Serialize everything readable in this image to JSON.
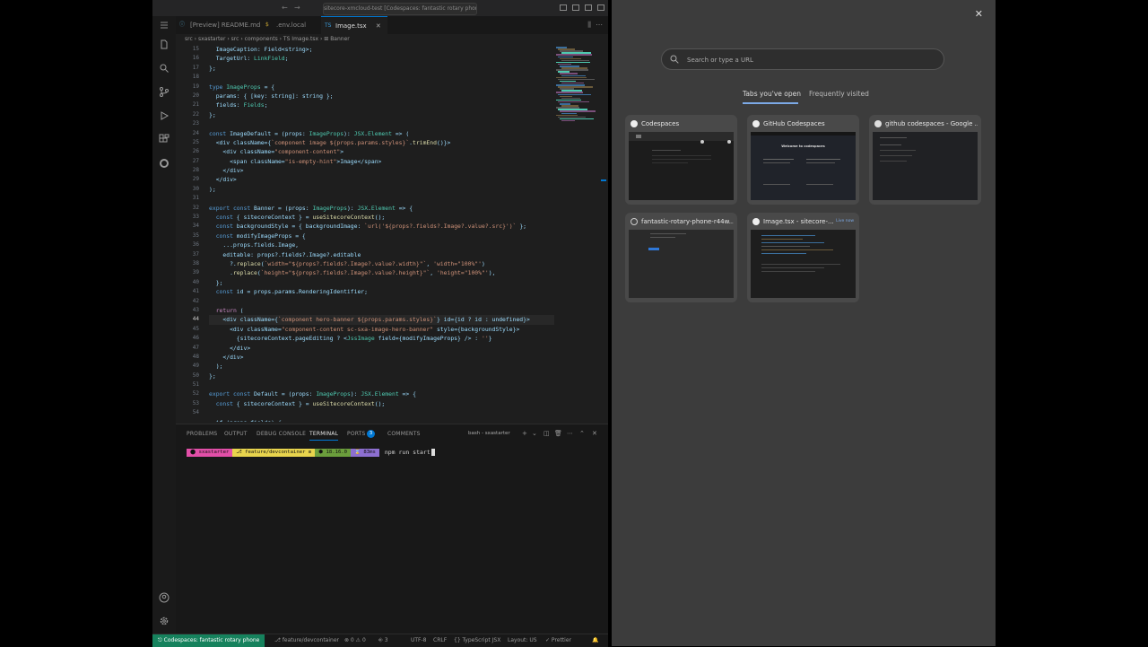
{
  "window": {
    "command_center": "sitecore-xmcloud-test [Codespaces: fantastic rotary phone]"
  },
  "tabs": [
    {
      "label": "[Preview] README.md",
      "icon": "md-icon"
    },
    {
      "label": ".env.local",
      "icon": "env-icon"
    },
    {
      "label": "Image.tsx",
      "icon": "tsx-icon",
      "active": true
    }
  ],
  "breadcrumb": "src › sxastarter › src › components › TS Image.tsx › ⊞ Banner",
  "editor": {
    "line_numbers": [
      "15",
      "16",
      "17",
      "18",
      "19",
      "20",
      "21",
      "22",
      "23",
      "24",
      "25",
      "26",
      "27",
      "28",
      "29",
      "30",
      "31",
      "32",
      "33",
      "34",
      "35",
      "36",
      "37",
      "38",
      "39",
      "40",
      "41",
      "42",
      "43",
      "44",
      "45",
      "46",
      "47",
      "48",
      "49",
      "50",
      "51",
      "52",
      "53",
      "54"
    ],
    "current_line_index": 29,
    "lines": [
      "  ImageCaption: Field<string>;",
      "  TargetUrl: LinkField;",
      "};",
      "",
      "type ImageProps = {",
      "  params: { [key: string]: string };",
      "  fields: Fields;",
      "};",
      "",
      "const ImageDefault = (props: ImageProps): JSX.Element => (",
      "  <div className={`component image ${props.params.styles}`.trimEnd()}>",
      "    <div className=\"component-content\">",
      "      <span className=\"is-empty-hint\">Image</span>",
      "    </div>",
      "  </div>",
      ");",
      "",
      "export const Banner = (props: ImageProps): JSX.Element => {",
      "  const { sitecoreContext } = useSitecoreContext();",
      "  const backgroundStyle = { backgroundImage: `url('${props?.fields?.Image?.value?.src}')` };",
      "  const modifyImageProps = {",
      "    ...props.fields.Image,",
      "    editable: props?.fields?.Image?.editable",
      "      ?.replace(`width=\"${props?.fields?.Image?.value?.width}\"`, 'width=\"100%\"')",
      "      .replace(`height=\"${props?.fields?.Image?.value?.height}\"`, 'height=\"100%\"'),",
      "  };",
      "  const id = props.params.RenderingIdentifier;",
      "",
      "  return (",
      "    <div className={`component hero-banner ${props.params.styles}`} id={id ? id : undefined}>",
      "      <div className=\"component-content sc-sxa-image-hero-banner\" style={backgroundStyle}>",
      "        {sitecoreContext.pageEditing ? <JssImage field={modifyImageProps} /> : ''}",
      "      </div>",
      "    </div>",
      "  );",
      "};",
      "",
      "export const Default = (props: ImageProps): JSX.Element => {",
      "  const { sitecoreContext } = useSitecoreContext();",
      "",
      "  if (props.fields) {"
    ]
  },
  "panel": {
    "tabs": [
      "PROBLEMS",
      "OUTPUT",
      "DEBUG CONSOLE",
      "TERMINAL",
      "PORTS",
      "COMMENTS"
    ],
    "active_tab": "TERMINAL",
    "ports_count": "3",
    "shell": "bash - sxastarter",
    "prompt_segments": [
      {
        "text": "⬤ sxastarter",
        "color": "#e24fa8"
      },
      {
        "text": "⎇ feature/devcontainer ≡",
        "color": "#e8d44d"
      },
      {
        "text": "⬢ 18.16.0",
        "color": "#6b9e3c"
      },
      {
        "text": "⌛ 83ms",
        "color": "#8d6fd1"
      }
    ],
    "command": "npm run start"
  },
  "status": {
    "remote": "⎋ Codespaces: fantastic rotary phone",
    "branch": "⎇ feature/devcontainer",
    "errors": "⊗ 0 ⚠ 0",
    "ports": "⎆ 3",
    "encoding": "UTF-8",
    "eol": "CRLF",
    "language": "{} TypeScript JSX",
    "layout": "Layout: US",
    "prettier": "✓ Prettier"
  },
  "newtab": {
    "search_placeholder": "Search or type a URL",
    "tabs": [
      "Tabs you've open",
      "Frequently visited"
    ],
    "cards": [
      {
        "title": "Codespaces",
        "favicon": "github-icon"
      },
      {
        "title": "GitHub Codespaces",
        "favicon": "github-icon"
      },
      {
        "title": "github codespaces - Google ...",
        "favicon": "google-icon"
      },
      {
        "title": "fantastic-rotary-phone-r44w...",
        "favicon": "loading-icon"
      },
      {
        "title": "Image.tsx - sitecore-...",
        "favicon": "github-icon",
        "badge": "Live now"
      }
    ],
    "thumb_welcome": "Welcome to codespaces"
  },
  "colors": {
    "keyword": "#569cd6",
    "control": "#c586c0",
    "function": "#dcdcaa",
    "string": "#ce9178",
    "type": "#4ec9b0",
    "variable": "#9cdcfe",
    "accent": "#0078d4"
  }
}
